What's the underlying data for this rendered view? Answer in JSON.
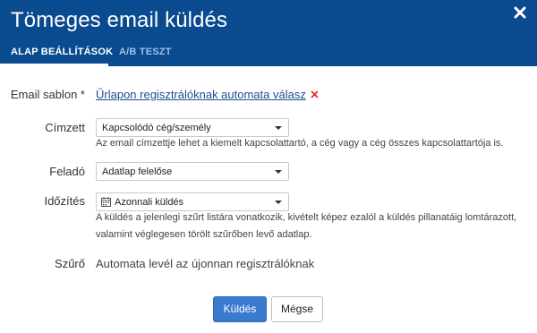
{
  "dialog": {
    "title": "Tömeges email küldés",
    "close_icon": "close-icon",
    "tabs": [
      {
        "label": "ALAP BEÁLLÍTÁSOK",
        "active": true
      },
      {
        "label": "A/B TESZT",
        "active": false
      }
    ]
  },
  "form": {
    "template": {
      "label": "Email sablon *",
      "value": "Űrlapon regisztrálóknak automata válasz",
      "remove_icon": "remove-icon"
    },
    "recipient": {
      "label": "Címzett",
      "value": "Kapcsolódó cég/személy",
      "help": "Az email címzettje lehet a kiemelt kapcsolattartó, a cég vagy a cég összes kapcsolattartója is."
    },
    "sender": {
      "label": "Feladó",
      "value": "Adatlap felelőse"
    },
    "timing": {
      "label": "Időzítés",
      "value": "Azonnali küldés",
      "icon": "calendar-icon",
      "help_line1": "A küldés a jelenlegi szűrt listára vonatkozik, kivételt képez ezalól a küldés pillanatáig lomtárazott,",
      "help_line2": "valamint véglegesen törölt szűrőben levő adatlap."
    },
    "filter": {
      "label": "Szűrő",
      "value": "Automata levél az újonnan regisztrálóknak"
    }
  },
  "actions": {
    "send_label": "Küldés",
    "cancel_label": "Mégse"
  },
  "colors": {
    "header": "#0a4a8f",
    "link": "#1d4f91",
    "primary_button": "#3a7bd0",
    "remove_x": "#d9302c"
  }
}
